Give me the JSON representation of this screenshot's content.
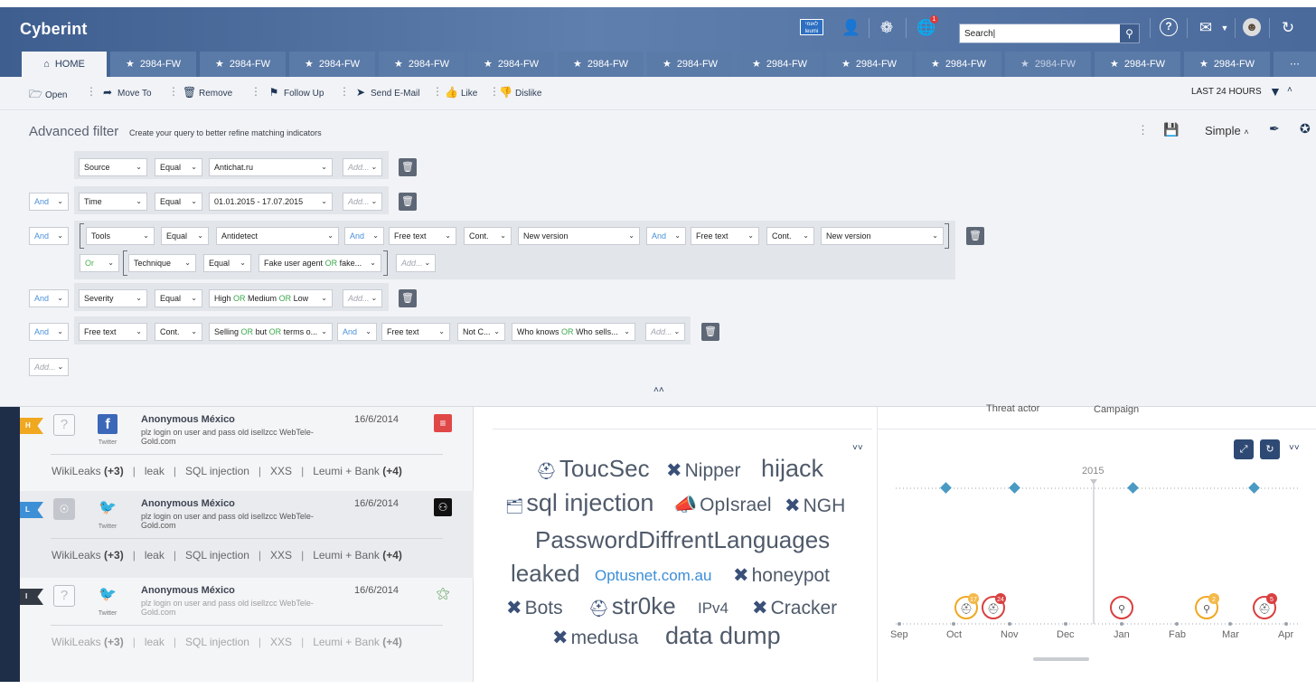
{
  "app": {
    "logo": "Cyberint",
    "bank_logo": "לאומי leumi"
  },
  "header": {
    "search": {
      "value": "Search|",
      "placeholder": "Search"
    },
    "globe_badge": "1"
  },
  "tabs": [
    {
      "label": "HOME"
    },
    {
      "label": "2984-FW"
    },
    {
      "label": "2984-FW"
    },
    {
      "label": "2984-FW"
    },
    {
      "label": "2984-FW"
    },
    {
      "label": "2984-FW"
    },
    {
      "label": "2984-FW"
    },
    {
      "label": "2984-FW"
    },
    {
      "label": "2984-FW"
    },
    {
      "label": "2984-FW"
    },
    {
      "label": "2984-FW"
    },
    {
      "label": "2984-FW"
    },
    {
      "label": "2984-FW"
    },
    {
      "label": "2984-FW"
    }
  ],
  "toolbar": {
    "open": "Open",
    "move_to": "Move To",
    "remove": "Remove",
    "follow_up": "Follow Up",
    "send_email": "Send E-Mail",
    "like": "Like",
    "dislike": "Dislike",
    "time_range": "LAST 24 HOURS"
  },
  "filter": {
    "title": "Advanced filter",
    "subtitle": "Create your query to better refine matching indicators",
    "mode": "Simple",
    "rows": {
      "r1": {
        "field": "Source",
        "op": "Equal",
        "value": "Antichat.ru",
        "add": "Add..."
      },
      "r2": {
        "logic": "And",
        "field": "Time",
        "op": "Equal",
        "value": "01.01.2015 - 17.07.2015",
        "add": "Add..."
      },
      "r3": {
        "logic": "And",
        "field": "Tools",
        "op": "Equal",
        "value": "Antidetect",
        "logic2": "And",
        "field2": "Free text",
        "op2": "Cont.",
        "value2": "New version",
        "logic3": "And",
        "field3": "Free text",
        "op3": "Cont.",
        "value3": "New version",
        "sub_logic": "Or",
        "sub_field": "Technique",
        "sub_op": "Equal",
        "sub_value_a": "Fake user agent",
        "sub_value_or": "OR",
        "sub_value_b": "fake...",
        "add": "Add..."
      },
      "r4": {
        "logic": "And",
        "field": "Severity",
        "op": "Equal",
        "value_a": "High",
        "or1": "OR",
        "value_b": "Medium",
        "or2": "OR",
        "value_c": "Low",
        "add": "Add..."
      },
      "r5": {
        "logic": "And",
        "field": "Free text",
        "op": "Cont.",
        "value_a": "Selling",
        "or1": "OR",
        "value_b": "but",
        "or2": "OR",
        "value_c": "terms o...",
        "logic2": "And",
        "field2": "Free text",
        "op2": "Not C...",
        "value2_a": "Who knows",
        "value2_or": "OR",
        "value2_b": "Who sells...",
        "add": "Add..."
      },
      "bottom_add": "Add..."
    }
  },
  "list": {
    "items": [
      {
        "flag": "H",
        "flag_color": "#f0a821",
        "social": "f",
        "social_label": "Twitter",
        "author": "Anonymous México",
        "snippet": "plz login on user and pass old isellzcc WebTele-Gold.com",
        "date": "16/6/2014",
        "src_color": "#e04848",
        "tags": {
          "t1": "WikiLeaks",
          "t1_count": "(+3)",
          "t2": "leak",
          "t3": "SQL injection",
          "t4": "XXS",
          "t5": "Leumi + Bank",
          "t5_count": "(+4)"
        }
      },
      {
        "flag": "L",
        "flag_color": "#3d8fd6",
        "social": "🐦",
        "social_label": "Twitter",
        "author": "Anonymous México",
        "snippet": "plz login on user and pass old isellzcc WebTele-Gold.com",
        "date": "16/6/2014",
        "src_color": "#111111",
        "tags": {
          "t1": "WikiLeaks",
          "t1_count": "(+3)",
          "t2": "leak",
          "t3": "SQL injection",
          "t4": "XXS",
          "t5": "Leumi + Bank",
          "t5_count": "(+4)"
        }
      },
      {
        "flag": "I",
        "flag_color": "#333a44",
        "social": "🐦",
        "social_label": "Twitter",
        "author": "Anonymous México",
        "snippet": "plz login on user and pass old isellzcc WebTele-Gold.com",
        "date": "16/6/2014",
        "src_color": "#ffffff",
        "tags": {
          "t1": "WikiLeaks",
          "t1_count": "(+3)",
          "t2": "leak",
          "t3": "SQL injection",
          "t4": "XXS",
          "t5": "Leumi + Bank",
          "t5_count": "(+4)"
        }
      }
    ]
  },
  "cloud": {
    "words": {
      "w1": "ToucSec",
      "w2": "Nipper",
      "w3": "hijack",
      "w4": "sql injection",
      "w5": "OpIsrael",
      "w6": "NGH",
      "w7": "PasswordDiffrentLanguages",
      "w8": "leaked",
      "w9": "Optusnet.com.au",
      "w10": "honeypot",
      "w11": "Bots",
      "w12": "str0ke",
      "w13": "IPv4",
      "w14": "Cracker",
      "w15": "medusa",
      "w16": "data dump"
    }
  },
  "timeline": {
    "threat_label": "Threat actor",
    "campaign_label": "Campaign",
    "year": "2015",
    "months": [
      "Sep",
      "Oct",
      "Nov",
      "Dec",
      "Jan",
      "Fab",
      "Mar",
      "Apr"
    ],
    "badges": {
      "b1": "17",
      "b2": "24",
      "b3": "2",
      "b4": "5"
    }
  }
}
